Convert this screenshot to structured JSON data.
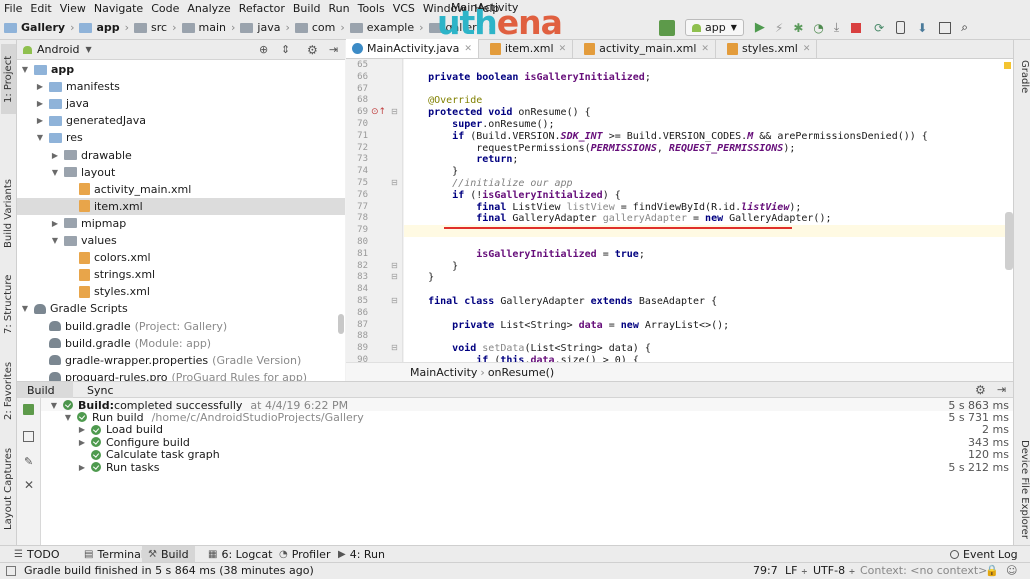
{
  "menu": [
    "File",
    "Edit",
    "View",
    "Navigate",
    "Code",
    "Analyze",
    "Refactor",
    "Build",
    "Run",
    "Tools",
    "VCS",
    "Window",
    "Help"
  ],
  "window_title": "MainActivity",
  "logo": {
    "part1": "uth",
    "part2": "ena",
    "color1": "#2db4c8",
    "color2": "#e06040"
  },
  "breadcrumb": [
    {
      "label": "Gallery",
      "bold": true
    },
    {
      "label": "app",
      "bold": true
    },
    {
      "label": "src",
      "bold": false
    },
    {
      "label": "main",
      "bold": false
    },
    {
      "label": "java",
      "bold": false
    },
    {
      "label": "com",
      "bold": false
    },
    {
      "label": "example",
      "bold": false
    },
    {
      "label": "gallery",
      "bold": false
    }
  ],
  "run_config": {
    "label": "app"
  },
  "left_strip_tabs": [
    "1: Project",
    "Build Variants",
    "7: Structure",
    "2: Favorites",
    "Layout Captures"
  ],
  "right_strip_tabs": [
    "Gradle",
    "Device File Explorer"
  ],
  "project": {
    "view_label": "Android",
    "tree": [
      {
        "label": "app",
        "depth": 0,
        "expanded": true,
        "icon": "folder",
        "bold": true
      },
      {
        "label": "manifests",
        "depth": 1,
        "expanded": false,
        "icon": "folder"
      },
      {
        "label": "java",
        "depth": 1,
        "expanded": false,
        "icon": "folder"
      },
      {
        "label": "generatedJava",
        "depth": 1,
        "expanded": false,
        "icon": "folder"
      },
      {
        "label": "res",
        "depth": 1,
        "expanded": true,
        "icon": "folder"
      },
      {
        "label": "drawable",
        "depth": 2,
        "expanded": false,
        "icon": "folder-res"
      },
      {
        "label": "layout",
        "depth": 2,
        "expanded": true,
        "icon": "folder-res"
      },
      {
        "label": "activity_main.xml",
        "depth": 3,
        "icon": "xml-file"
      },
      {
        "label": "item.xml",
        "depth": 3,
        "icon": "xml-file",
        "selected": true
      },
      {
        "label": "mipmap",
        "depth": 2,
        "expanded": false,
        "icon": "folder-res"
      },
      {
        "label": "values",
        "depth": 2,
        "expanded": true,
        "icon": "folder-res"
      },
      {
        "label": "colors.xml",
        "depth": 3,
        "icon": "xml-file"
      },
      {
        "label": "strings.xml",
        "depth": 3,
        "icon": "xml-file"
      },
      {
        "label": "styles.xml",
        "depth": 3,
        "icon": "xml-file"
      },
      {
        "label": "Gradle Scripts",
        "depth": 0,
        "expanded": true,
        "icon": "gradle"
      },
      {
        "label": "build.gradle",
        "suffix": "(Project: Gallery)",
        "depth": 1,
        "icon": "gradle"
      },
      {
        "label": "build.gradle",
        "suffix": "(Module: app)",
        "depth": 1,
        "icon": "gradle"
      },
      {
        "label": "gradle-wrapper.properties",
        "suffix": "(Gradle Version)",
        "depth": 1,
        "icon": "gradle"
      },
      {
        "label": "proguard-rules.pro",
        "suffix": "(ProGuard Rules for app)",
        "depth": 1,
        "icon": "gradle"
      }
    ]
  },
  "editor_tabs": [
    {
      "label": "MainActivity.java",
      "active": true
    },
    {
      "label": "item.xml",
      "active": false
    },
    {
      "label": "activity_main.xml",
      "active": false
    },
    {
      "label": "styles.xml",
      "active": false
    }
  ],
  "code": [
    {
      "n": "65",
      "t": []
    },
    {
      "n": "66",
      "t": [
        [
          "    ",
          ""
        ],
        [
          "private boolean ",
          "kw"
        ],
        [
          "isGalleryInitialized",
          "fld"
        ],
        [
          ";",
          ""
        ]
      ]
    },
    {
      "n": "67",
      "t": []
    },
    {
      "n": "68",
      "t": [
        [
          "    @Override",
          "ann"
        ]
      ]
    },
    {
      "n": "69",
      "t": [
        [
          "    ",
          ""
        ],
        [
          "protected void ",
          "kw"
        ],
        [
          "onResume() {",
          ""
        ]
      ]
    },
    {
      "n": "70",
      "t": [
        [
          "        ",
          ""
        ],
        [
          "super",
          "kw"
        ],
        [
          ".onResume();",
          ""
        ]
      ]
    },
    {
      "n": "71",
      "t": [
        [
          "        ",
          ""
        ],
        [
          "if ",
          "kw"
        ],
        [
          "(Build.VERSION.",
          ""
        ],
        [
          "SDK_INT",
          "cst"
        ],
        [
          " >= Build.VERSION_CODES.",
          ""
        ],
        [
          "M",
          "cst"
        ],
        [
          " && arePermissionsDenied()) {",
          ""
        ]
      ]
    },
    {
      "n": "72",
      "t": [
        [
          "            requestPermissions(",
          ""
        ],
        [
          "PERMISSIONS",
          "cst"
        ],
        [
          ", ",
          ""
        ],
        [
          "REQUEST_PERMISSIONS",
          "cst"
        ],
        [
          ");",
          ""
        ]
      ]
    },
    {
      "n": "73",
      "t": [
        [
          "            ",
          ""
        ],
        [
          "return",
          "kw"
        ],
        [
          ";",
          ""
        ]
      ]
    },
    {
      "n": "74",
      "t": [
        [
          "        }",
          ""
        ]
      ]
    },
    {
      "n": "75",
      "t": [
        [
          "        //initialize our app",
          "cmt"
        ]
      ]
    },
    {
      "n": "76",
      "t": [
        [
          "        ",
          ""
        ],
        [
          "if ",
          "kw"
        ],
        [
          "(!",
          ""
        ],
        [
          "isGalleryInitialized",
          "fld"
        ],
        [
          ") {",
          ""
        ]
      ]
    },
    {
      "n": "77",
      "t": [
        [
          "            ",
          ""
        ],
        [
          "final ",
          "kw"
        ],
        [
          "ListView ",
          ""
        ],
        [
          "listView",
          "gry"
        ],
        [
          " = findViewById(R.id.",
          ""
        ],
        [
          "listView",
          "cst"
        ],
        [
          ");",
          ""
        ]
      ]
    },
    {
      "n": "78",
      "t": [
        [
          "            ",
          ""
        ],
        [
          "final ",
          "kw"
        ],
        [
          "GalleryAdapter ",
          ""
        ],
        [
          "galleryAdapter",
          "gry"
        ],
        [
          " = ",
          ""
        ],
        [
          "new ",
          "kw"
        ],
        [
          "GalleryAdapter();",
          ""
        ]
      ]
    },
    {
      "n": "79",
      "t": [],
      "current": true
    },
    {
      "n": "80",
      "t": []
    },
    {
      "n": "81",
      "t": [
        [
          "            ",
          ""
        ],
        [
          "isGalleryInitialized",
          "fld"
        ],
        [
          " = ",
          ""
        ],
        [
          "true",
          "kw"
        ],
        [
          ";",
          ""
        ]
      ]
    },
    {
      "n": "82",
      "t": [
        [
          "        }",
          ""
        ]
      ]
    },
    {
      "n": "83",
      "t": [
        [
          "    }",
          ""
        ]
      ]
    },
    {
      "n": "84",
      "t": []
    },
    {
      "n": "85",
      "t": [
        [
          "    ",
          ""
        ],
        [
          "final class ",
          "kw"
        ],
        [
          "GalleryAdapter ",
          ""
        ],
        [
          "extends ",
          "kw"
        ],
        [
          "BaseAdapter {",
          ""
        ]
      ]
    },
    {
      "n": "86",
      "t": []
    },
    {
      "n": "87",
      "t": [
        [
          "        ",
          ""
        ],
        [
          "private ",
          "kw"
        ],
        [
          "List<String> ",
          ""
        ],
        [
          "data",
          "fld"
        ],
        [
          " = ",
          ""
        ],
        [
          "new ",
          "kw"
        ],
        [
          "ArrayList<>();",
          ""
        ]
      ]
    },
    {
      "n": "88",
      "t": []
    },
    {
      "n": "89",
      "t": [
        [
          "        ",
          ""
        ],
        [
          "void ",
          "kw"
        ],
        [
          "setData",
          "gry"
        ],
        [
          "(List<String> data) {",
          ""
        ]
      ]
    },
    {
      "n": "90",
      "t": [
        [
          "            ",
          ""
        ],
        [
          "if ",
          "kw"
        ],
        [
          "(",
          ""
        ],
        [
          "this",
          "kw"
        ],
        [
          ".",
          ""
        ],
        [
          "data",
          "fld"
        ],
        [
          ".size() > 0) {",
          ""
        ]
      ]
    }
  ],
  "editor_breadcrumb": [
    "MainActivity",
    "onResume()"
  ],
  "build_panel": {
    "tabs": [
      "Build",
      "Sync"
    ],
    "rows": [
      {
        "depth": 0,
        "expanded": true,
        "bold_label": "Build:",
        "label": " completed successfully",
        "extra": "at 4/4/19 6:22 PM",
        "duration": "5 s 863 ms"
      },
      {
        "depth": 1,
        "expanded": true,
        "label": "Run build",
        "extra": "/home/c/AndroidStudioProjects/Gallery",
        "duration": "5 s 731 ms"
      },
      {
        "depth": 2,
        "expanded": false,
        "label": "Load build",
        "extra": "",
        "duration": "2 ms"
      },
      {
        "depth": 2,
        "expanded": false,
        "label": "Configure build",
        "extra": "",
        "duration": "343 ms"
      },
      {
        "depth": 2,
        "leaf": true,
        "label": "Calculate task graph",
        "extra": "",
        "duration": "120 ms"
      },
      {
        "depth": 2,
        "expanded": false,
        "label": "Run tasks",
        "extra": "",
        "duration": "5 s 212 ms"
      }
    ]
  },
  "bottom_tabs": [
    {
      "label": "TODO",
      "active": false
    },
    {
      "label": "Terminal",
      "active": false
    },
    {
      "label": "Build",
      "active": true
    },
    {
      "label": "6: Logcat",
      "active": false
    },
    {
      "label": "Profiler",
      "active": false
    },
    {
      "label": "4: Run",
      "active": false
    }
  ],
  "event_log_label": "Event Log",
  "status": {
    "message": "Gradle build finished in 5 s 864 ms (38 minutes ago)",
    "position": "79:7",
    "line_sep": "LF",
    "encoding": "UTF-8",
    "context": "Context: <no context>"
  }
}
